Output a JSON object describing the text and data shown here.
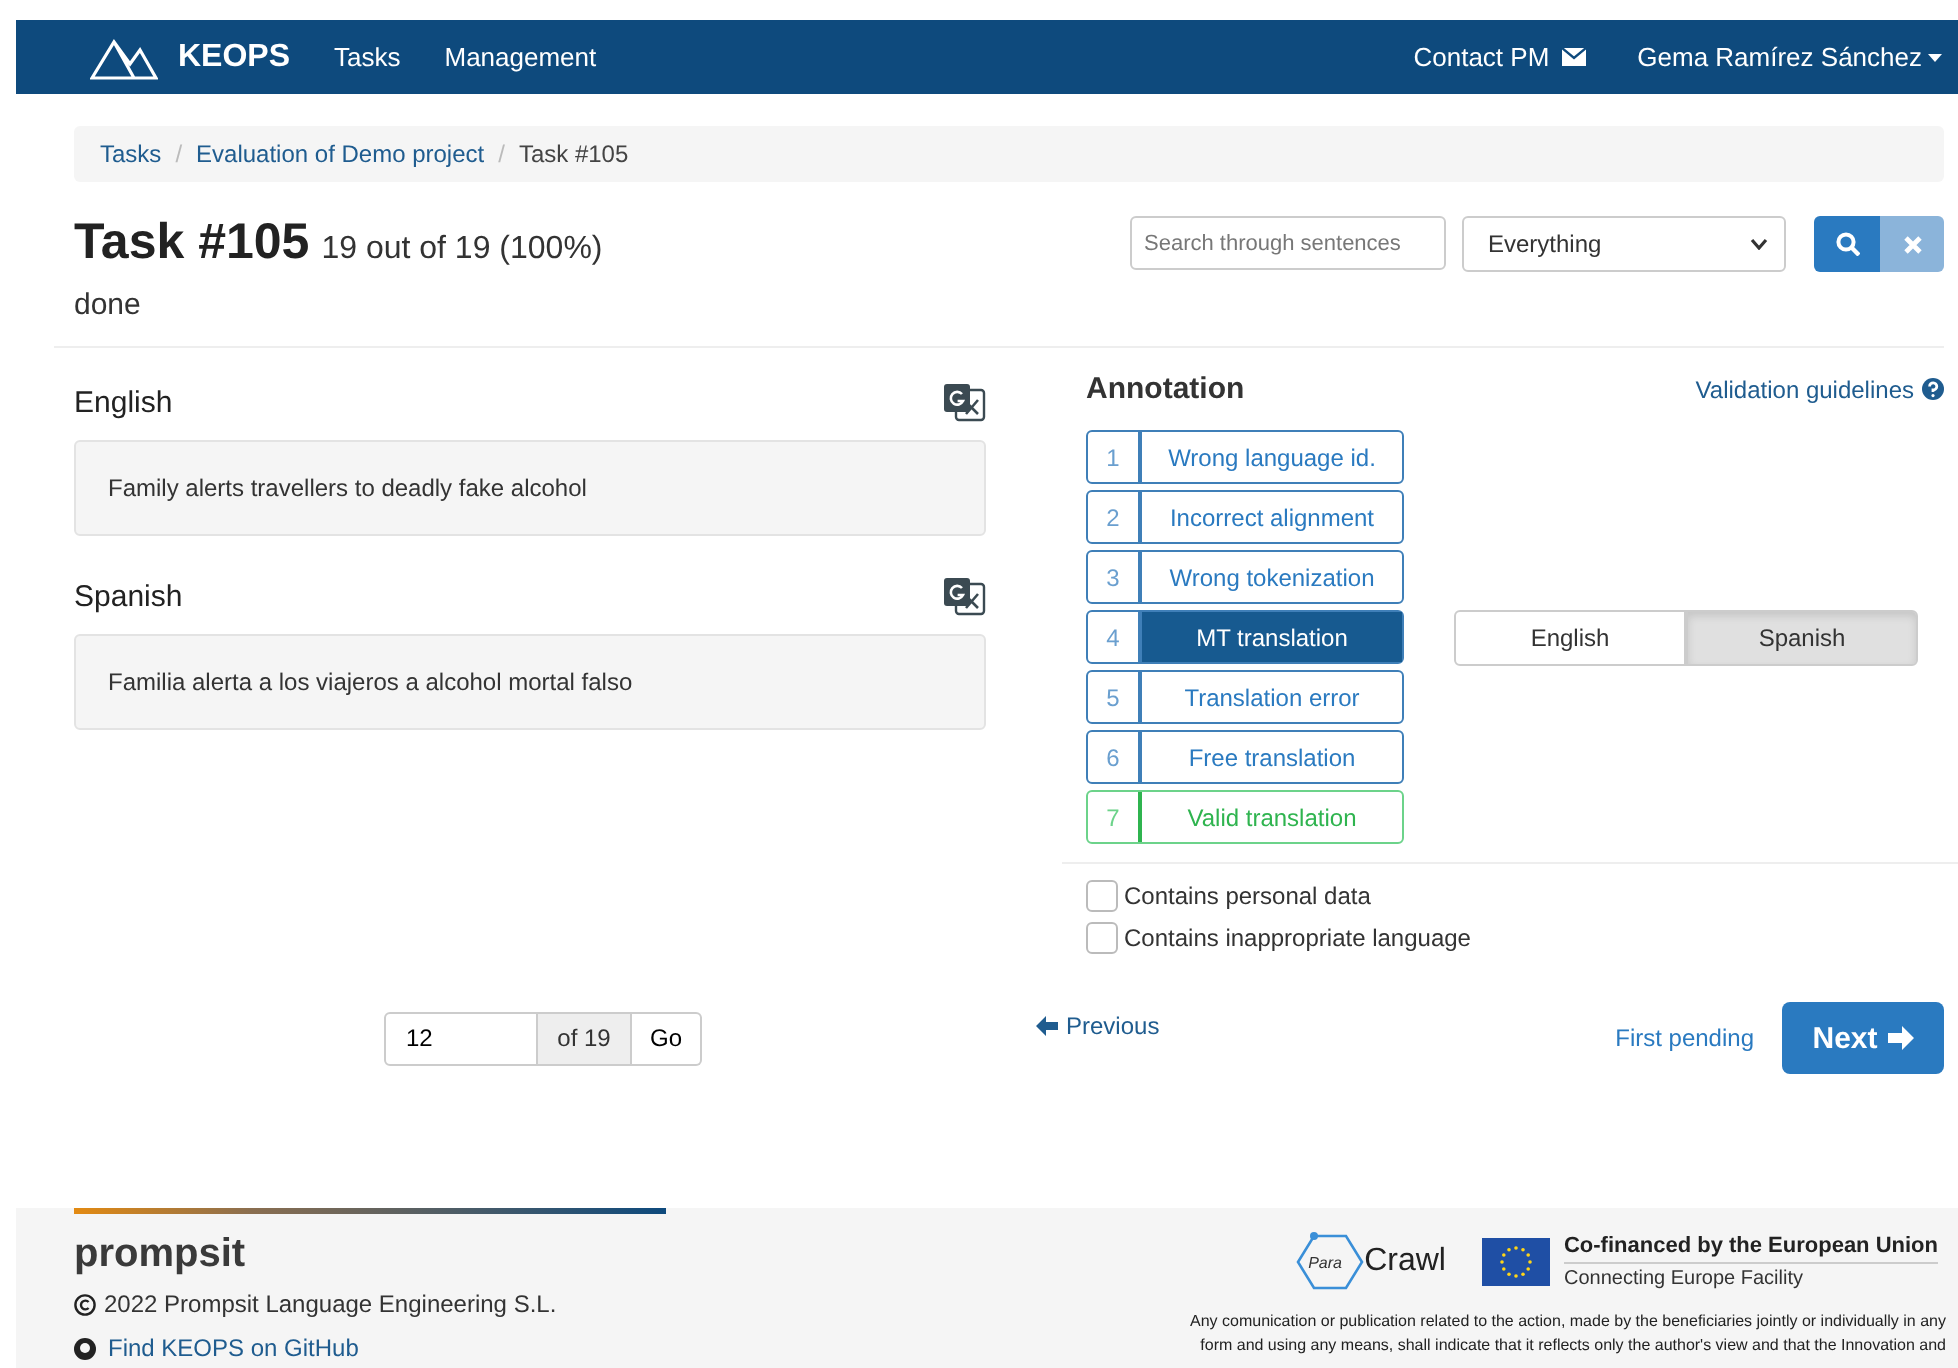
{
  "navbar": {
    "brand": "KEOPS",
    "links": [
      {
        "label": "Tasks"
      },
      {
        "label": "Management"
      }
    ],
    "contact": "Contact PM",
    "user": "Gema Ramírez Sánchez"
  },
  "breadcrumb": [
    {
      "label": "Tasks",
      "link": true
    },
    {
      "separator": "/",
      "label": "Evaluation of Demo project",
      "link": true
    },
    {
      "separator": "/",
      "label": "Task #105",
      "link": false
    }
  ],
  "task": {
    "title": "Task #105",
    "progress": "19 out of 19 (100%)",
    "status": "done"
  },
  "search": {
    "placeholder": "Search through sentences",
    "filter": "Everything"
  },
  "sentences": [
    {
      "language": "English",
      "text": "Family alerts travellers to deadly fake alcohol"
    },
    {
      "language": "Spanish",
      "text": "Familia alerta a los viajeros a alcohol mortal falso"
    }
  ],
  "annotation": {
    "title": "Annotation",
    "guidelines": "Validation guidelines",
    "options": [
      {
        "key": "1",
        "label": "Wrong language id.",
        "kind": "error",
        "selected": false
      },
      {
        "key": "2",
        "label": "Incorrect alignment",
        "kind": "error",
        "selected": false
      },
      {
        "key": "3",
        "label": "Wrong tokenization",
        "kind": "error",
        "selected": false
      },
      {
        "key": "4",
        "label": "MT translation",
        "kind": "error",
        "selected": true
      },
      {
        "key": "5",
        "label": "Translation error",
        "kind": "error",
        "selected": false
      },
      {
        "key": "6",
        "label": "Free translation",
        "kind": "error",
        "selected": false
      },
      {
        "key": "7",
        "label": "Valid translation",
        "kind": "valid",
        "selected": false
      }
    ],
    "languages": [
      {
        "label": "English",
        "selected": false
      },
      {
        "label": "Spanish",
        "selected": true
      }
    ],
    "checks": [
      {
        "label": "Contains personal data",
        "checked": false
      },
      {
        "label": "Contains inappropriate language",
        "checked": false
      }
    ]
  },
  "pager": {
    "value": "12",
    "total": "of 19",
    "go": "Go",
    "previous": "Previous",
    "first_pending": "First pending",
    "next": "Next"
  },
  "footer": {
    "brand": "prompsit",
    "copyright": "2022 Prompsit Language Engineering S.L.",
    "github": "Find KEOPS on GitHub",
    "paracrawl": "Crawl",
    "paracrawl_small": "Para",
    "eu_title": "Co-financed by the European Union",
    "eu_sub": "Connecting Europe Facility",
    "disclaimer": [
      "Any comunication or publication related to the action, made by the beneficiaries jointly or individually in any",
      "form and using any means, shall indicate that it reflects only the author's view and that the Innovation and"
    ]
  }
}
